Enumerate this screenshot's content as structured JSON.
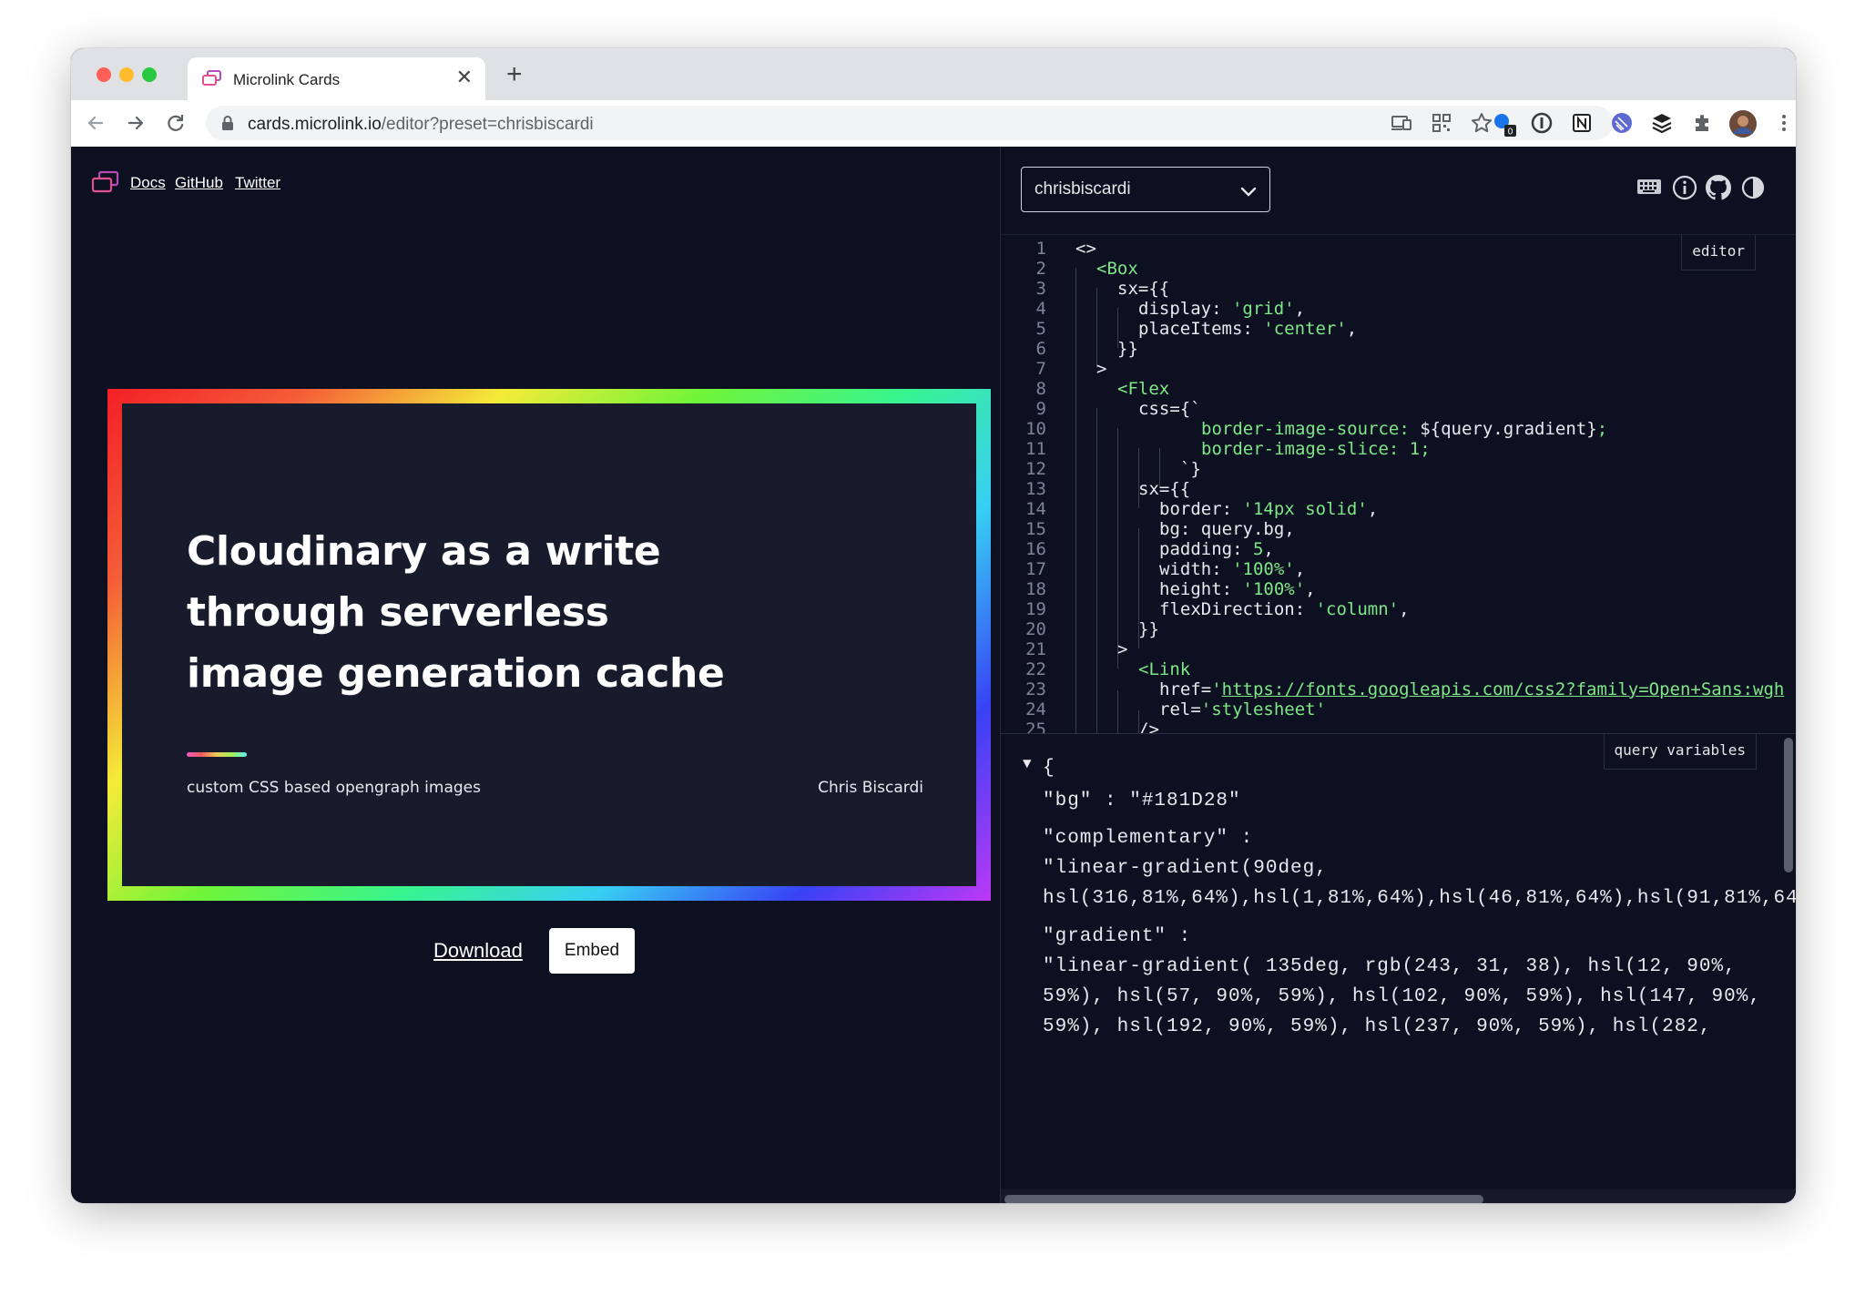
{
  "browser": {
    "tab_title": "Microlink Cards",
    "tab_close": "✕",
    "new_tab": "+",
    "url_host": "cards.microlink.io",
    "url_path": "/editor?preset=chrisbiscardi",
    "extension_badge": "0"
  },
  "nav": {
    "links": [
      "Docs",
      "GitHub",
      "Twitter"
    ]
  },
  "card": {
    "title_lines": [
      "Cloudinary as a write",
      "through serverless",
      "image generation cache"
    ],
    "subtitle": "custom CSS based opengraph images",
    "author": "Chris Biscardi",
    "bg": "#181D28"
  },
  "actions": {
    "download": "Download",
    "embed": "Embed"
  },
  "preset_select": {
    "value": "chrisbiscardi"
  },
  "editor": {
    "label": "editor",
    "lines": [
      {
        "n": "1"
      },
      {
        "n": "2"
      },
      {
        "n": "3"
      },
      {
        "n": "4"
      },
      {
        "n": "5"
      },
      {
        "n": "6"
      },
      {
        "n": "7"
      },
      {
        "n": "8"
      },
      {
        "n": "9"
      },
      {
        "n": "10"
      },
      {
        "n": "11"
      },
      {
        "n": "12"
      },
      {
        "n": "13"
      },
      {
        "n": "14"
      },
      {
        "n": "15"
      },
      {
        "n": "16"
      },
      {
        "n": "17"
      },
      {
        "n": "18"
      },
      {
        "n": "19"
      },
      {
        "n": "20"
      },
      {
        "n": "21"
      },
      {
        "n": "22"
      },
      {
        "n": "23"
      },
      {
        "n": "24"
      },
      {
        "n": "25"
      }
    ],
    "code": {
      "l1": "<>",
      "l2_tag": "<Box",
      "l3": "sx={{",
      "l4_key": "display: ",
      "l4_val": "'grid'",
      "l4_end": ",",
      "l5_key": "placeItems: ",
      "l5_val": "'center'",
      "l5_end": ",",
      "l6": "}}",
      "l7": ">",
      "l8_tag": "<Flex",
      "l9": "css={`",
      "l10_prop": "border-image-source: ",
      "l10_val": "${query.gradient}",
      "l10_end": ";",
      "l11_prop": "border-image-slice: 1;",
      "l12": "`}",
      "l13": "sx={{",
      "l14_key": "border: ",
      "l14_val": "'14px solid'",
      "l14_end": ",",
      "l15": "bg: query.bg,",
      "l16_key": "padding: ",
      "l16_val": "5",
      "l16_end": ",",
      "l17_key": "width: ",
      "l17_val": "'100%'",
      "l17_end": ",",
      "l18_key": "height: ",
      "l18_val": "'100%'",
      "l18_end": ",",
      "l19_key": "flexDirection: ",
      "l19_val": "'column'",
      "l19_end": ",",
      "l20": "}}",
      "l21": ">",
      "l22_tag": "<Link",
      "l23_key": "href=",
      "l23_q": "'",
      "l23_url": "https://fonts.googleapis.com/css2?family=Open+Sans:wgh",
      "l24_key": "rel=",
      "l24_val": "'stylesheet'",
      "l25": "/>"
    }
  },
  "query_variables": {
    "label": "query variables",
    "toggle": "▼",
    "open_brace": "{",
    "bg_key": "\"bg\" : ",
    "bg_val": "\"#181D28\"",
    "complementary_key": "\"complementary\" :",
    "complementary_val_1": "\"linear-gradient(90deg,",
    "complementary_val_2": "hsl(316,81%,64%),hsl(1,81%,64%),hsl(46,81%,64%),hsl(91,81%,64",
    "gradient_key": "\"gradient\" :",
    "gradient_val_1": "\"linear-gradient( 135deg, rgb(243, 31, 38), hsl(12, 90%,",
    "gradient_val_2": "59%), hsl(57, 90%, 59%), hsl(102, 90%, 59%), hsl(147, 90%,",
    "gradient_val_3": "59%), hsl(192, 90%, 59%), hsl(237, 90%, 59%), hsl(282,"
  },
  "icons": {
    "tab_favicon": "microlink-icon",
    "keyboard": "keyboard-icon",
    "info": "info-icon",
    "github": "github-icon",
    "theme": "contrast-icon"
  }
}
